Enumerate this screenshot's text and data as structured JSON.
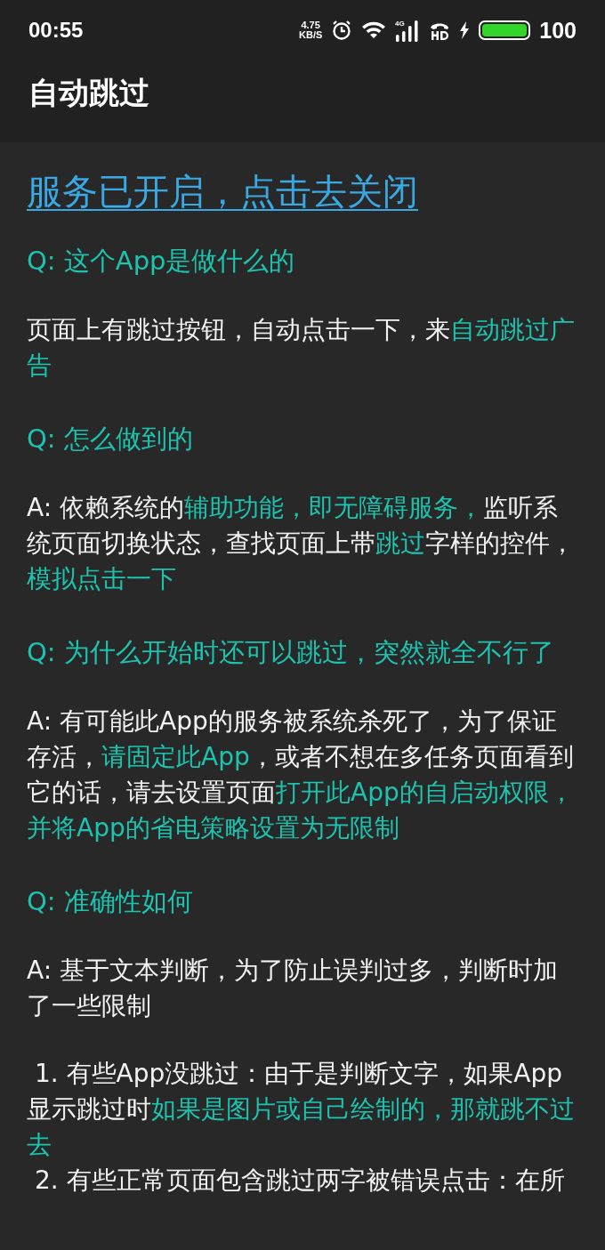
{
  "status_bar": {
    "time": "00:55",
    "net_speed": "4.75",
    "net_unit": "KB/S",
    "signal_label": "4G",
    "battery": "100"
  },
  "app_bar": {
    "title": "自动跳过"
  },
  "service_link": "服务已开启，点击去关闭",
  "blocks": [
    {
      "kind": "question",
      "text": "Q: 这个App是做什么的"
    },
    {
      "kind": "answer",
      "segments": [
        {
          "text": "页面上有跳过按钮，自动点击一下，来",
          "highlight": false
        },
        {
          "text": "自动跳过广告",
          "highlight": true
        }
      ]
    },
    {
      "kind": "question",
      "text": "Q: 怎么做到的"
    },
    {
      "kind": "answer",
      "segments": [
        {
          "text": "A: 依赖系统的",
          "highlight": false
        },
        {
          "text": "辅助功能，即无障碍服务，",
          "highlight": true
        },
        {
          "text": "监听系统页面切换状态，查找页面上带",
          "highlight": false
        },
        {
          "text": "跳过",
          "highlight": true
        },
        {
          "text": "字样的控件，",
          "highlight": false
        },
        {
          "text": "模拟点击一下",
          "highlight": true
        }
      ]
    },
    {
      "kind": "question",
      "text": "Q: 为什么开始时还可以跳过，突然就全不行了"
    },
    {
      "kind": "answer",
      "segments": [
        {
          "text": "A: 有可能此App的服务被系统杀死了，为了保证存活，",
          "highlight": false
        },
        {
          "text": "请固定此App",
          "highlight": true
        },
        {
          "text": "，或者不想在多任务页面看到它的话，请去设置页面",
          "highlight": false
        },
        {
          "text": "打开此App的自启动权限，并将App的省电策略设置为无限制",
          "highlight": true
        }
      ]
    },
    {
      "kind": "question",
      "text": "Q: 准确性如何"
    },
    {
      "kind": "answer",
      "segments": [
        {
          "text": "A: 基于文本判断，为了防止误判过多，判断时加了一些限制",
          "highlight": false
        }
      ]
    },
    {
      "kind": "item",
      "segments": [
        {
          "text": " 1. 有些App没跳过：由于是判断文字，如果App显示跳过时",
          "highlight": false
        },
        {
          "text": "如果是图片或自己绘制的，那就跳不过去",
          "highlight": true
        }
      ]
    },
    {
      "kind": "item",
      "segments": [
        {
          "text": " 2. 有些正常页面包含跳过两字被错误点击：在所",
          "highlight": false
        }
      ]
    }
  ]
}
